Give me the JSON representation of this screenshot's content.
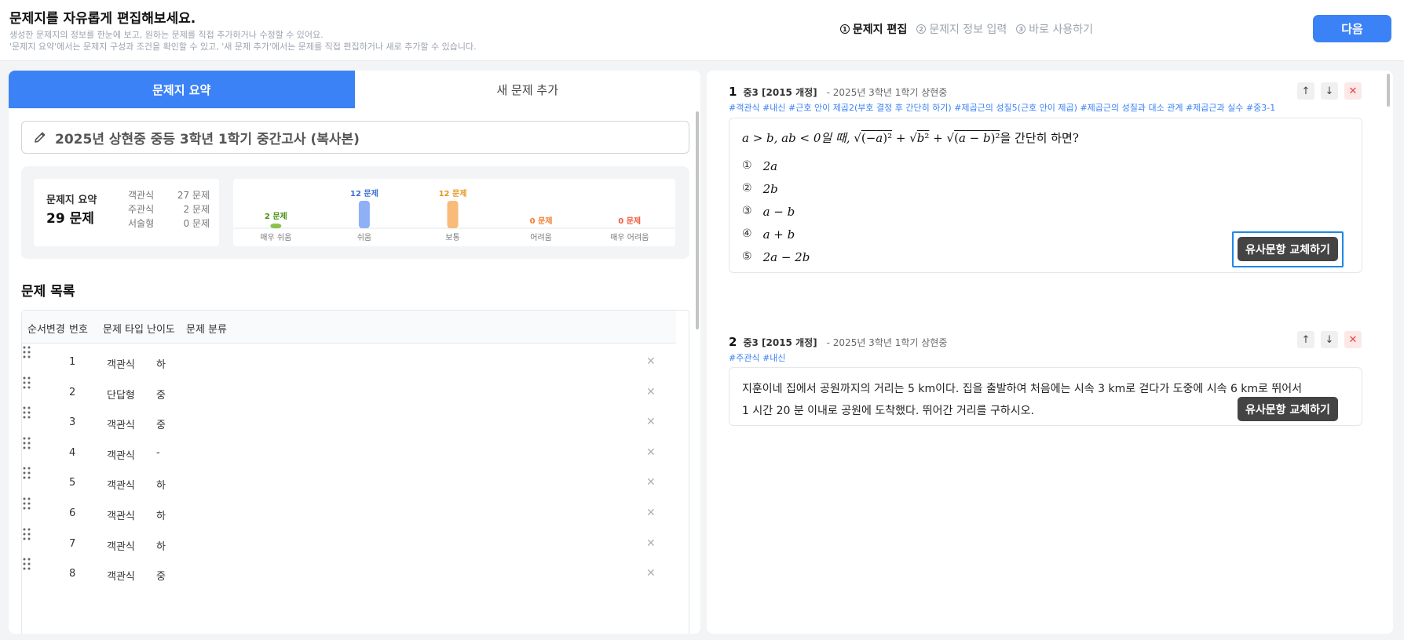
{
  "header": {
    "title": "문제지를 자유롭게 편집해보세요.",
    "desc1": "생성한 문제지의 정보를 한눈에 보고, 원하는 문제를 직접 추가하거나 수정할 수 있어요.",
    "desc2": "'문제지 요약'에서는 문제지 구성과 조건을 확인할 수 있고, '새 문제 추가'에서는 문제를 직접 편집하거나 새로 추가할 수 있습니다.",
    "steps": [
      {
        "num": "1",
        "label": "문제지 편집",
        "active": true
      },
      {
        "num": "2",
        "label": "문제지 정보 입력",
        "active": false
      },
      {
        "num": "3",
        "label": "바로 사용하기",
        "active": false
      }
    ],
    "next_label": "다음"
  },
  "left": {
    "tabs": [
      {
        "label": "문제지 요약"
      },
      {
        "label": "새 문제 추가"
      }
    ],
    "sheet_title": "2025년 상현중 중등 3학년 1학기 중간고사 (복사본)",
    "summary": {
      "label": "문제지 요약",
      "total": "29 문제",
      "types": [
        {
          "type": "객관식",
          "count": "27 문제"
        },
        {
          "type": "주관식",
          "count": "2 문제"
        },
        {
          "type": "서술형",
          "count": "0 문제"
        }
      ]
    },
    "list_title": "문제 목록",
    "columns": [
      "순서변경",
      "번호",
      "문제 타입",
      "난이도",
      "문제 분류"
    ],
    "rows": [
      {
        "no": "1",
        "type": "객관식",
        "level": "하"
      },
      {
        "no": "2",
        "type": "단답형",
        "level": "중"
      },
      {
        "no": "3",
        "type": "객관식",
        "level": "중"
      },
      {
        "no": "4",
        "type": "객관식",
        "level": "-"
      },
      {
        "no": "5",
        "type": "객관식",
        "level": "하"
      },
      {
        "no": "6",
        "type": "객관식",
        "level": "하"
      },
      {
        "no": "7",
        "type": "객관식",
        "level": "하"
      },
      {
        "no": "8",
        "type": "객관식",
        "level": "중"
      }
    ]
  },
  "chart_data": {
    "type": "bar",
    "categories": [
      "매우 쉬움",
      "쉬움",
      "보통",
      "어려움",
      "매우 어려움"
    ],
    "values": [
      2,
      12,
      12,
      0,
      0
    ],
    "data_labels": [
      "2 문제",
      "12 문제",
      "12 문제",
      "0 문제",
      "0 문제"
    ],
    "colors": [
      "#8bc34a",
      "#8fb0f7",
      "#f8bb7a",
      "#f47c2c",
      "#f05a3a"
    ],
    "label_colors": [
      "#4a8f14",
      "#3b6fd8",
      "#e8951f",
      "#f47c2c",
      "#f05a3a"
    ],
    "ylim": [
      0,
      12
    ]
  },
  "questions": [
    {
      "num": "1",
      "grade": "중3 [2015 개정]",
      "source": "- 2025년 3학년 1학기 상현중",
      "tags": "#객관식 #내신 #근호 안이 제곱2(부호 결정 후 간단히 하기) #제곱근의 성질5(근호 안이 제곱) #제곱근의 성질과 대소 관계 #제곱근과 실수 #중3-1",
      "stem_pre": "a > b, ab < 0일 때,",
      "stem_post": "을 간단히 하면?",
      "choices": [
        {
          "mark": "①",
          "text": "2a"
        },
        {
          "mark": "②",
          "text": "2b"
        },
        {
          "mark": "③",
          "text": "a − b"
        },
        {
          "mark": "④",
          "text": "a + b"
        },
        {
          "mark": "⑤",
          "text": "2a − 2b"
        }
      ],
      "replace_label": "유사문항 교체하기"
    },
    {
      "num": "2",
      "grade": "중3 [2015 개정]",
      "source": "- 2025년 3학년 1학기 상현중",
      "tags": "#주관식 #내신",
      "line1": "지훈이네 집에서 공원까지의 거리는 5 km이다. 집을 출발하여 처음에는 시속 3 km로 걷다가 도중에 시속 6 km로 뛰어서",
      "line2": "1 시간 20 분 이내로 공원에 도착했다. 뛰어간 거리를 구하시오.",
      "replace_label": "유사문항 교체하기"
    }
  ],
  "icons": {
    "pencil": "pencil-icon",
    "grip": "drag-handle-icon",
    "up": "arrow-up-icon",
    "down": "arrow-down-icon",
    "close": "close-icon"
  }
}
